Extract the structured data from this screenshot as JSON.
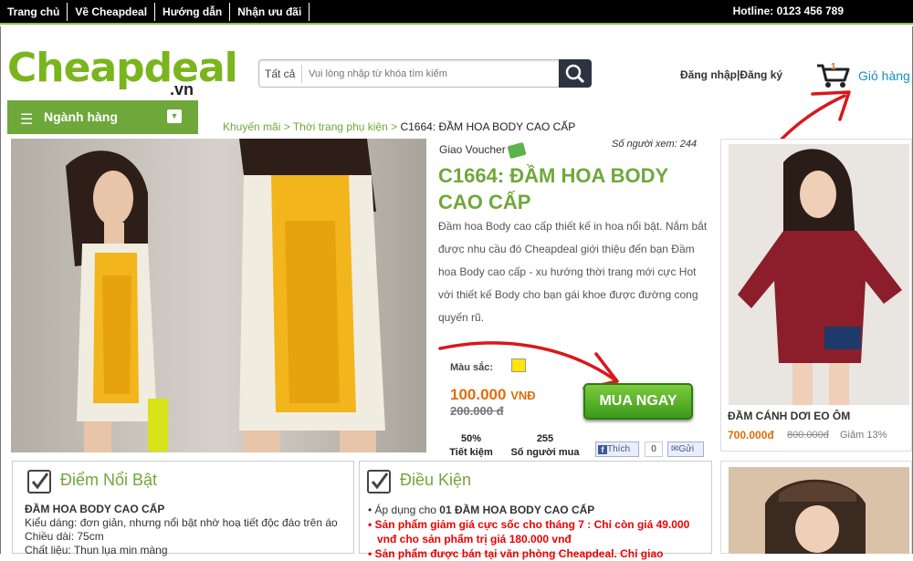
{
  "topnav": {
    "items": [
      "Trang chủ",
      "Về Cheapdeal",
      "Hướng dẫn",
      "Nhận ưu đãi"
    ],
    "hotline": "Hotline: 0123 456 789"
  },
  "logo": {
    "name": "Cheapdeal",
    "suffix": ".vn"
  },
  "search": {
    "category": "Tất cả",
    "placeholder": "Vui lòng nhập từ khóa tìm kiếm"
  },
  "account": {
    "login": "Đăng nhập",
    "register": "Đăng ký"
  },
  "cart": {
    "count": "1",
    "label": "Giỏ hàng"
  },
  "category_menu": {
    "label": "Ngành hàng"
  },
  "breadcrumb": {
    "items": [
      "Khuyến mãi",
      "Thời trang phụ kiện"
    ],
    "separator": " > ",
    "current": "C1664: ĐẦM HOA BODY CAO CẤP"
  },
  "product": {
    "voucher_label": "Giao Voucher",
    "viewers": "Số người xem: 244",
    "title": "C1664: ĐẦM HOA BODY CAO CẤP",
    "description": "Đầm hoa Body cao cấp thiết kế in hoa nổi bật. Nắm bắt được nhu cầu đó Cheapdeal giới thiệu đến bạn Đầm hoa Body cao cấp - xu hướng thời trang mới cực Hot với thiết kế Body cho bạn gái khoe được đường cong quyến rũ.",
    "color_label": "Màu sắc:",
    "swatch_color": "#ffe600",
    "price": "100.000",
    "currency": "VNĐ",
    "old_price": "200.000 đ",
    "buy_label": "MUA NGAY",
    "savings_value": "50%",
    "savings_label": "Tiết kiệm",
    "buyers_value": "255",
    "buyers_label": "Số người mua",
    "like_label": "Thích",
    "like_count": "0",
    "send_label": "Gửi"
  },
  "sidebar": {
    "item1": {
      "name": "ĐẦM CÁNH DƠI EO ÔM",
      "price": "700.000đ",
      "old_price": "800.000đ",
      "discount": "Giảm 13%"
    }
  },
  "highlights": {
    "title": "Điểm Nổi Bật",
    "lines": [
      "ĐẦM HOA BODY CAO CẤP",
      "Kiểu dáng: đơn giản, nhưng nổi bật nhờ hoạ tiết độc đáo trên áo",
      "Chiều dài: 75cm",
      "Chất liệu: Thun lụa min màng"
    ]
  },
  "conditions": {
    "title": "Điều Kiện",
    "line1_prefix": "Áp dụng cho ",
    "line1_bold": "01 ĐẦM HOA BODY CAO CẤP",
    "line2": "Sản phẩm giảm giá cực sốc cho tháng 7 : Chỉ còn giá 49.000 vnđ cho sản phẩm trị giá 180.000 vnđ",
    "line3": "Sản phẩm được bán tại văn phòng Cheapdeal. Chỉ giao"
  },
  "colors": {
    "brand_green": "#6fa83a",
    "price_orange": "#e36c0a",
    "link_blue": "#1a8ec4"
  }
}
